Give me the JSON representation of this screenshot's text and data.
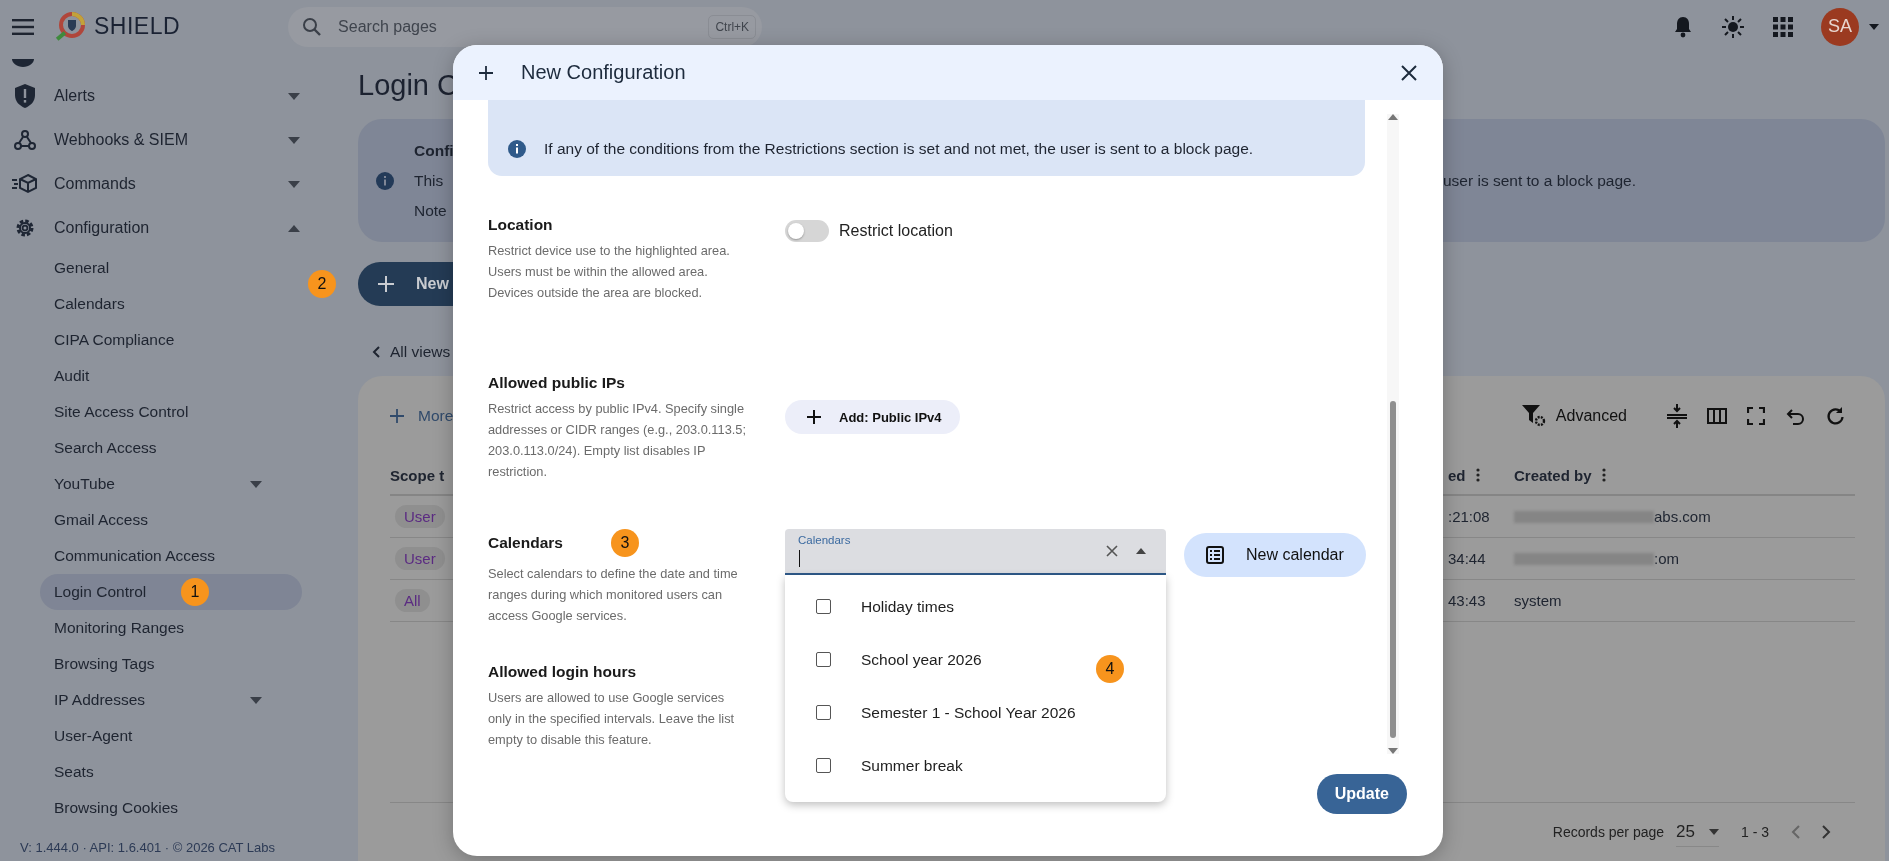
{
  "topbar": {
    "brand": "SHIELD",
    "search": {
      "placeholder": "Search pages",
      "shortcut": "Ctrl+K"
    },
    "avatar": "SA"
  },
  "sidebar": {
    "items": [
      {
        "label": "Alerts",
        "expanded": false
      },
      {
        "label": "Webhooks & SIEM",
        "expanded": false
      },
      {
        "label": "Commands",
        "expanded": false
      },
      {
        "label": "Configuration",
        "expanded": true,
        "children": [
          {
            "label": "General",
            "selected": false
          },
          {
            "label": "Calendars",
            "selected": false
          },
          {
            "label": "CIPA Compliance",
            "selected": false
          },
          {
            "label": "Audit",
            "selected": false
          },
          {
            "label": "Site Access Control",
            "selected": false
          },
          {
            "label": "Search Access",
            "selected": false
          },
          {
            "label": "YouTube",
            "selected": false,
            "expanded": false
          },
          {
            "label": "Gmail Access",
            "selected": false
          },
          {
            "label": "Communication Access",
            "selected": false
          },
          {
            "label": "Login Control",
            "selected": true,
            "badge": "1"
          },
          {
            "label": "Monitoring Ranges",
            "selected": false
          },
          {
            "label": "Browsing Tags",
            "selected": false
          },
          {
            "label": "IP Addresses",
            "selected": false,
            "expanded": false
          },
          {
            "label": "User-Agent",
            "selected": false
          },
          {
            "label": "Seats",
            "selected": false
          },
          {
            "label": "Browsing Cookies",
            "selected": false
          }
        ]
      }
    ],
    "footer": "V: 1.444.0 · API: 1.6.401 · © 2026 CAT Labs"
  },
  "main": {
    "title": "Login C",
    "info": {
      "title": "Confi",
      "lines": [
        "This",
        "Note"
      ],
      "tail": "user is sent to a block page."
    },
    "new_button": {
      "label": "New",
      "badge": "2"
    },
    "back_link": "All views",
    "table": {
      "more": "More",
      "advanced": "Advanced",
      "columns": [
        "Scope t",
        "ed",
        "Created by"
      ],
      "rows": [
        {
          "scope": "User",
          "time": ":21:08",
          "created_by": "abs.com",
          "redacted": true
        },
        {
          "scope": "User",
          "time": "34:44",
          "created_by": ":om",
          "redacted": true
        },
        {
          "scope": "All",
          "time": "43:43",
          "created_by": "system",
          "redacted": false
        }
      ],
      "pagination": {
        "label": "Records per page",
        "per_page": "25",
        "range": "1 - 3"
      }
    }
  },
  "modal": {
    "title": "New Configuration",
    "banner": "If any of the conditions from the Restrictions section is set and not met, the user is sent to a block page.",
    "sections": [
      {
        "kind": "toggle",
        "title": "Location",
        "description": "Restrict device use to the highlighted area. Users must be within the allowed area. Devices outside the area are blocked.",
        "toggle": {
          "label": "Restrict location",
          "on": false
        }
      },
      {
        "kind": "add",
        "title": "Allowed public IPs",
        "description": "Restrict access by public IPv4. Specify single addresses or CIDR ranges (e.g., 203.0.113.5; 203.0.113.0/24). Empty list disables IP restriction.",
        "button": "Add: Public IPv4"
      },
      {
        "kind": "select",
        "title": "Calendars",
        "badge": "3",
        "description": "Select calendars to define the date and time ranges during which monitored users can access Google services.",
        "field": {
          "label": "Calendars",
          "badge": "4",
          "options": [
            {
              "label": "Holiday times",
              "checked": false
            },
            {
              "label": "School year 2026",
              "checked": false
            },
            {
              "label": "Semester 1 - School Year 2026",
              "checked": false
            },
            {
              "label": "Summer break",
              "checked": false
            }
          ]
        },
        "button": "New calendar"
      },
      {
        "kind": "plain",
        "title": "Allowed login hours",
        "description": "Users are allowed to use Google services only in the specified intervals. Leave the list empty to disable this feature."
      }
    ],
    "update_button": "Update"
  }
}
